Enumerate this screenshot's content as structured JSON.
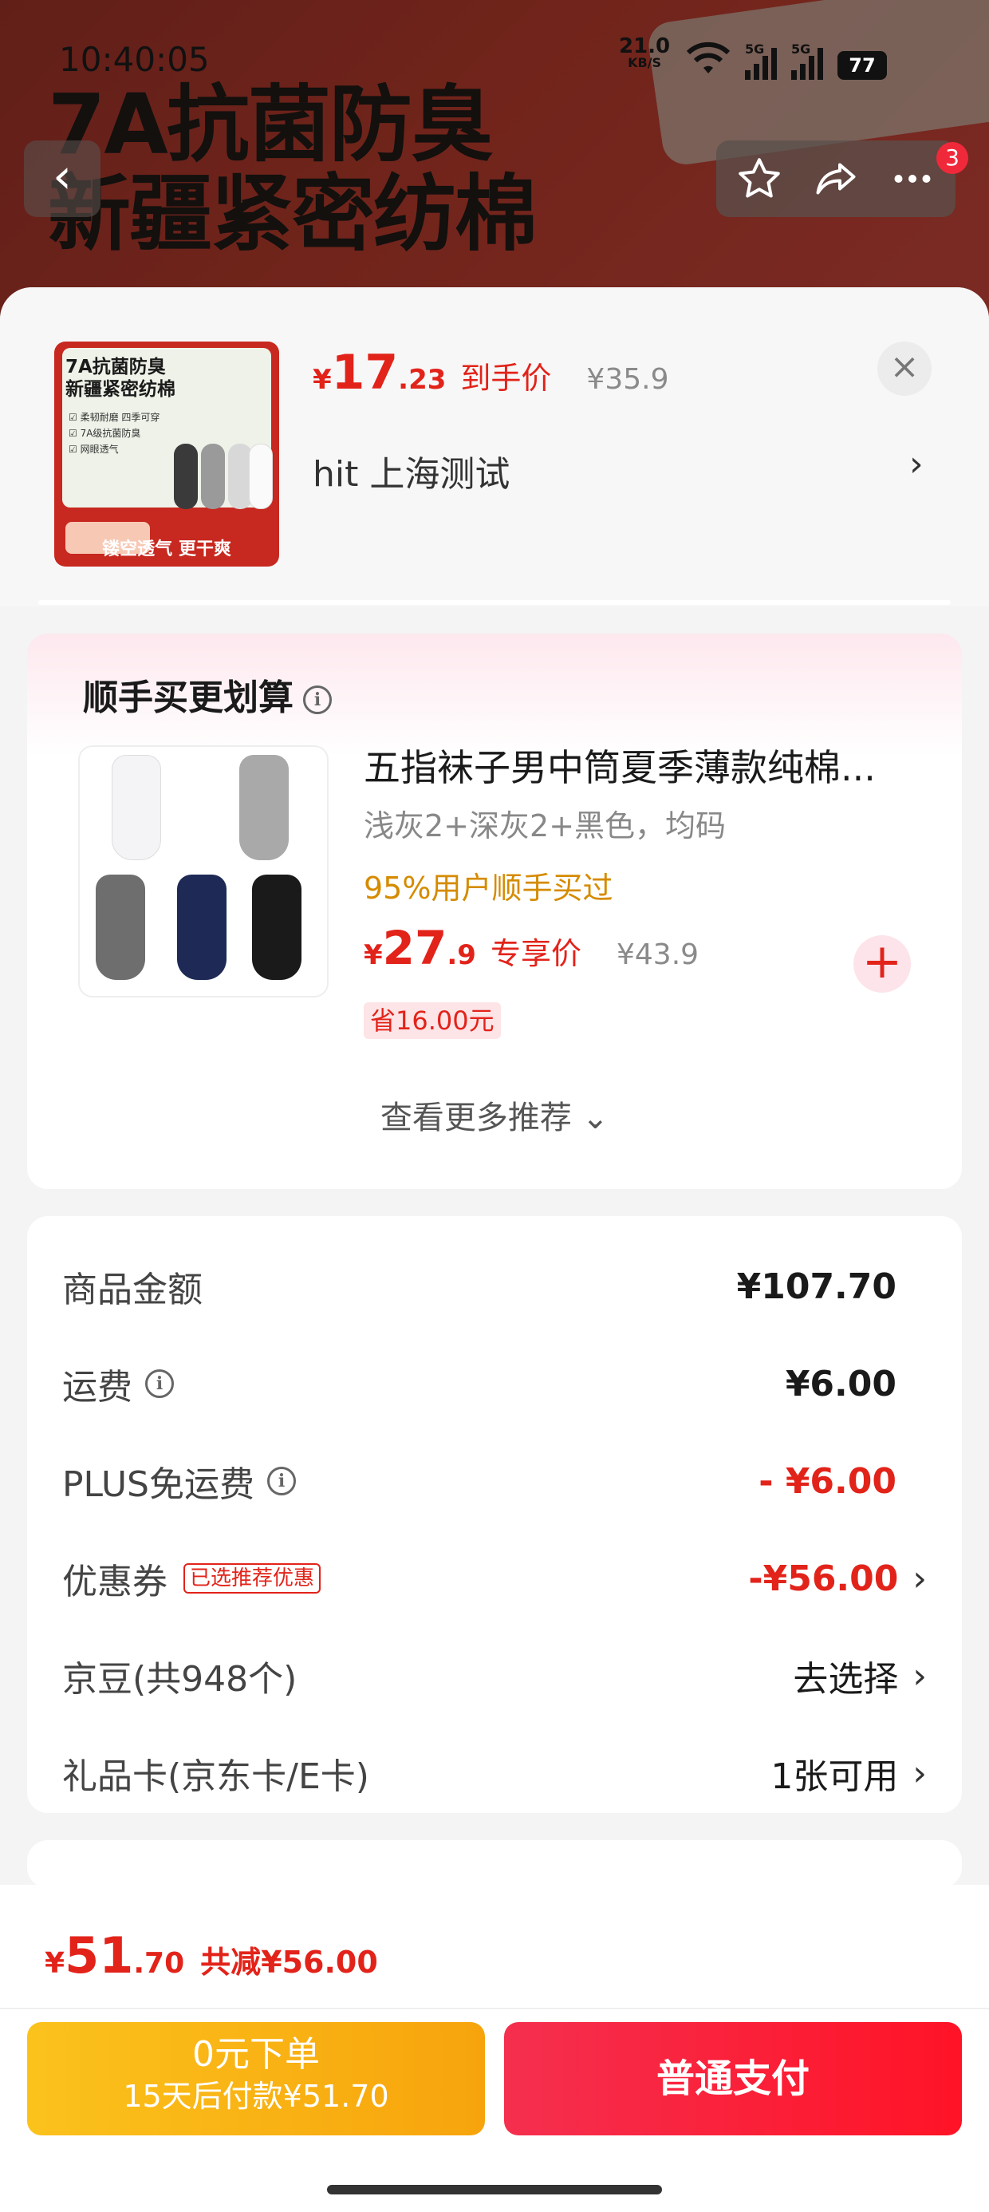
{
  "status": {
    "time": "10:40:05",
    "net_speed": "21.0",
    "net_unit": "KB/S",
    "sim1": "5G",
    "sim2": "5G",
    "battery": "77"
  },
  "background": {
    "banner_line1": "7A抗菌防臭",
    "banner_line2": "新疆紧密纺棉"
  },
  "nav": {
    "badge_count": "3"
  },
  "product": {
    "currency": "¥",
    "price_int": "17",
    "price_dec": ".23",
    "price_tag": "到手价",
    "original_price": "¥35.9",
    "address": "hit  上海测试",
    "thumb_title_line1": "7A抗菌防臭",
    "thumb_title_line2": "新疆紧密纺棉",
    "thumb_bullet1": "☑ 柔韧耐磨 四季可穿",
    "thumb_bullet2": "☑ 7A级抗菌防臭",
    "thumb_bullet3": "☑ 网眼透气",
    "thumb_footer": "镂空透气 更干爽"
  },
  "addon": {
    "title": "顺手买更划算",
    "item_name": "五指袜子男中筒夏季薄款纯棉...",
    "item_spec": "浅灰2+深灰2+黑色，均码",
    "bought_note": "95%用户顺手买过",
    "currency": "¥",
    "price_int": "27",
    "price_dec": ".9",
    "price_tag": "专享价",
    "original_price": "¥43.9",
    "save_label": "省16.00元",
    "more_label": "查看更多推荐 ⌄"
  },
  "summary": {
    "rows": [
      {
        "label": "商品金额",
        "value": "¥107.70"
      },
      {
        "label": "运费",
        "value": "¥6.00"
      },
      {
        "label": "PLUS免运费",
        "value": "- ¥6.00"
      },
      {
        "label": "优惠券",
        "tag": "已选推荐优惠",
        "value": "-¥56.00"
      },
      {
        "label": "京豆(共948个)",
        "value": "去选择"
      },
      {
        "label": "礼品卡(京东卡/E卡)",
        "value": "1张可用"
      }
    ]
  },
  "footer": {
    "currency": "¥",
    "total_int": "51",
    "total_dec": ".70",
    "reduce_label": "共减¥56.00",
    "zero_pay_line1": "0元下单",
    "zero_pay_line2": "15天后付款¥51.70",
    "normal_pay": "普通支付"
  },
  "colors": {
    "accent_red": "#e2231a",
    "zero_pay_yellow": "#fbc21c",
    "pay_red": "#ff1326",
    "bought_orange": "#d58b00"
  },
  "icons": [
    "back-icon",
    "star-icon",
    "share-icon",
    "more-icon",
    "close-icon",
    "chevron-right-icon",
    "info-icon",
    "plus-icon",
    "chevron-down-icon",
    "wifi-icon",
    "signal-icon",
    "battery-icon"
  ]
}
